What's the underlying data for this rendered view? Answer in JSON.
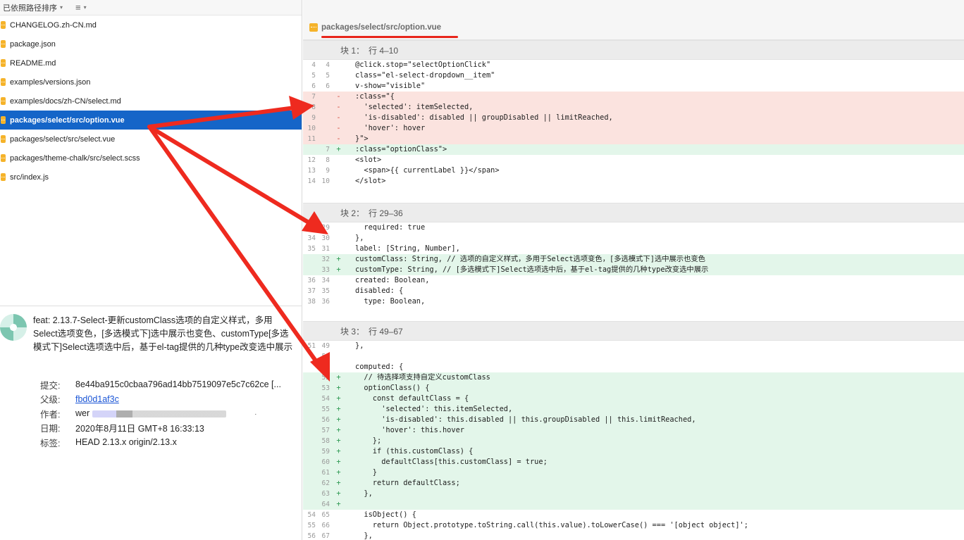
{
  "toolbar": {
    "sort_label": "已依照路径排序",
    "caret": "⌄",
    "list_icon": "≡"
  },
  "files": [
    {
      "name": "CHANGELOG.zh-CN.md",
      "selected": false
    },
    {
      "name": "package.json",
      "selected": false
    },
    {
      "name": "README.md",
      "selected": false
    },
    {
      "name": "examples/versions.json",
      "selected": false
    },
    {
      "name": "examples/docs/zh-CN/select.md",
      "selected": false
    },
    {
      "name": "packages/select/src/option.vue",
      "selected": true
    },
    {
      "name": "packages/select/src/select.vue",
      "selected": false
    },
    {
      "name": "packages/theme-chalk/src/select.scss",
      "selected": false
    },
    {
      "name": "src/index.js",
      "selected": false
    }
  ],
  "commit": {
    "message": "feat: 2.13.7-Select-更新customClass选项的自定义样式，多用Select选项变色，[多选模式下]选中展示也变色、customType[多选模式下]Select选项选中后，基于el-tag提供的几种type改变选中展示",
    "fields": {
      "commit_label": "提交:",
      "commit_value": "8e44ba915c0cbaa796ad14bb7519097e5c7c62ce [...",
      "parent_label": "父级:",
      "parent_value": "fbd0d1af3c",
      "author_label": "作者:",
      "author_value": "wer",
      "date_label": "日期:",
      "date_value": "2020年8月11日 GMT+8 16:33:13",
      "tags_label": "标签:",
      "tags_value": "HEAD 2.13.x origin/2.13.x"
    },
    "author_redaction_mark": "·"
  },
  "diff": {
    "file_path": "packages/select/src/option.vue",
    "hunks": [
      {
        "title": "块 1：",
        "range": "行 4–10",
        "lines": [
          {
            "o": "4",
            "n": "4",
            "t": " ",
            "code": "@click.stop=\"selectOptionClick\""
          },
          {
            "o": "5",
            "n": "5",
            "t": " ",
            "code": "class=\"el-select-dropdown__item\""
          },
          {
            "o": "6",
            "n": "6",
            "t": " ",
            "code": "v-show=\"visible\""
          },
          {
            "o": "7",
            "n": "",
            "t": "-",
            "code": ":class=\"{"
          },
          {
            "o": "8",
            "n": "",
            "t": "-",
            "code": "  'selected': itemSelected,"
          },
          {
            "o": "9",
            "n": "",
            "t": "-",
            "code": "  'is-disabled': disabled || groupDisabled || limitReached,"
          },
          {
            "o": "10",
            "n": "",
            "t": "-",
            "code": "  'hover': hover"
          },
          {
            "o": "11",
            "n": "",
            "t": "-",
            "code": "}\">"
          },
          {
            "o": "",
            "n": "7",
            "t": "+",
            "code": ":class=\"optionClass\">"
          },
          {
            "o": "12",
            "n": "8",
            "t": " ",
            "code": "<slot>"
          },
          {
            "o": "13",
            "n": "9",
            "t": " ",
            "code": "  <span>{{ currentLabel }}</span>"
          },
          {
            "o": "14",
            "n": "10",
            "t": " ",
            "code": "</slot>"
          }
        ]
      },
      {
        "title": "块 2：",
        "range": "行 29–36",
        "lines": [
          {
            "o": "33",
            "n": "29",
            "t": " ",
            "code": "  required: true"
          },
          {
            "o": "34",
            "n": "30",
            "t": " ",
            "code": "},"
          },
          {
            "o": "35",
            "n": "31",
            "t": " ",
            "code": "label: [String, Number],"
          },
          {
            "o": "",
            "n": "32",
            "t": "+",
            "code": "customClass: String, // 选项的自定义样式，多用于Select选项变色，[多选模式下]选中展示也变色"
          },
          {
            "o": "",
            "n": "33",
            "t": "+",
            "code": "customType: String, // [多选模式下]Select选项选中后，基于el-tag提供的几种type改变选中展示"
          },
          {
            "o": "36",
            "n": "34",
            "t": " ",
            "code": "created: Boolean,"
          },
          {
            "o": "37",
            "n": "35",
            "t": " ",
            "code": "disabled: {"
          },
          {
            "o": "38",
            "n": "36",
            "t": " ",
            "code": "  type: Boolean,"
          }
        ]
      },
      {
        "title": "块 3：",
        "range": "行 49–67",
        "lines": [
          {
            "o": "51",
            "n": "49",
            "t": " ",
            "code": "},"
          },
          {
            "o": "",
            "n": "50",
            "t": " ",
            "code": ""
          },
          {
            "o": "",
            "n": "51",
            "t": " ",
            "code": "computed: {"
          },
          {
            "o": "",
            "n": "52",
            "t": "+",
            "code": "  // 待选择项支持自定义customClass"
          },
          {
            "o": "",
            "n": "53",
            "t": "+",
            "code": "  optionClass() {"
          },
          {
            "o": "",
            "n": "54",
            "t": "+",
            "code": "    const defaultClass = {"
          },
          {
            "o": "",
            "n": "55",
            "t": "+",
            "code": "      'selected': this.itemSelected,"
          },
          {
            "o": "",
            "n": "56",
            "t": "+",
            "code": "      'is-disabled': this.disabled || this.groupDisabled || this.limitReached,"
          },
          {
            "o": "",
            "n": "57",
            "t": "+",
            "code": "      'hover': this.hover"
          },
          {
            "o": "",
            "n": "58",
            "t": "+",
            "code": "    };"
          },
          {
            "o": "",
            "n": "59",
            "t": "+",
            "code": "    if (this.customClass) {"
          },
          {
            "o": "",
            "n": "60",
            "t": "+",
            "code": "      defaultClass[this.customClass] = true;"
          },
          {
            "o": "",
            "n": "61",
            "t": "+",
            "code": "    }"
          },
          {
            "o": "",
            "n": "62",
            "t": "+",
            "code": "    return defaultClass;"
          },
          {
            "o": "",
            "n": "63",
            "t": "+",
            "code": "  },"
          },
          {
            "o": "",
            "n": "64",
            "t": "+",
            "code": ""
          },
          {
            "o": "54",
            "n": "65",
            "t": " ",
            "code": "  isObject() {"
          },
          {
            "o": "55",
            "n": "66",
            "t": " ",
            "code": "    return Object.prototype.toString.call(this.value).toLowerCase() === '[object object]';"
          },
          {
            "o": "56",
            "n": "67",
            "t": " ",
            "code": "  },"
          }
        ]
      }
    ]
  },
  "colors": {
    "selection": "#1565c8",
    "annotation": "#e8261c",
    "deleted_bg": "#fbe3df",
    "added_bg": "#e3f6ea",
    "file_icon": "#f5b32a"
  }
}
